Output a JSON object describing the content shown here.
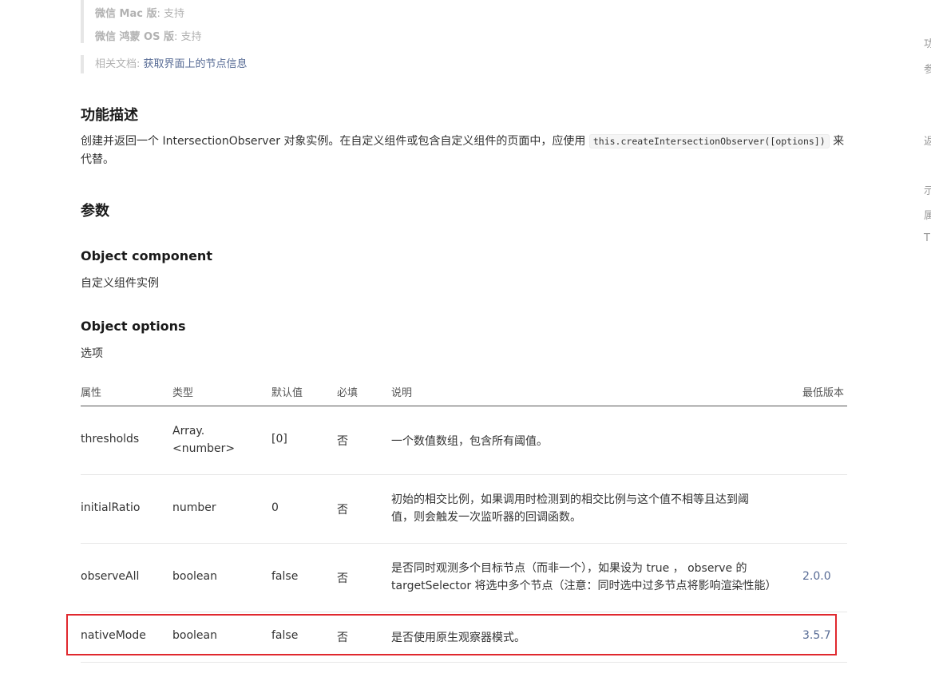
{
  "support": {
    "mac_label": "微信 Mac 版",
    "mac_value": "支持",
    "harmony_label": "微信 鸿蒙 OS 版",
    "harmony_value": "支持",
    "separator": ": "
  },
  "related_doc": {
    "label": "相关文档: ",
    "link_text": "获取界面上的节点信息"
  },
  "function": {
    "heading": "功能描述",
    "text_before": "创建并返回一个 IntersectionObserver 对象实例。在自定义组件或包含自定义组件的页面中，应使用 ",
    "code": "this.createIntersectionObserver([options])",
    "text_after": " 来代替。"
  },
  "params": {
    "heading": "参数",
    "component": {
      "heading": "Object component",
      "description": "自定义组件实例"
    },
    "options": {
      "heading": "Object options",
      "description": "选项"
    }
  },
  "table": {
    "headers": {
      "property": "属性",
      "type": "类型",
      "default": "默认值",
      "required": "必填",
      "description": "说明",
      "min_version": "最低版本"
    },
    "rows": [
      {
        "property": "thresholds",
        "type": "Array.<number>",
        "default": "[0]",
        "required": "否",
        "description": "一个数值数组，包含所有阈值。",
        "min_version": ""
      },
      {
        "property": "initialRatio",
        "type": "number",
        "default": "0",
        "required": "否",
        "description": "初始的相交比例，如果调用时检测到的相交比例与这个值不相等且达到阈值，则会触发一次监听器的回调函数。",
        "min_version": ""
      },
      {
        "property": "observeAll",
        "type": "boolean",
        "default": "false",
        "required": "否",
        "description": "是否同时观测多个目标节点（而非一个），如果设为 true ， observe 的 targetSelector 将选中多个节点（注意：同时选中过多节点将影响渲染性能）",
        "min_version": "2.0.0"
      },
      {
        "property": "nativeMode",
        "type": "boolean",
        "default": "false",
        "required": "否",
        "description": "是否使用原生观察器模式。",
        "min_version": "3.5.7"
      }
    ]
  },
  "right_rail": [
    "功",
    "参",
    "返",
    "示",
    "属",
    "T"
  ],
  "colors": {
    "link": "#576b95",
    "highlight": "#e0282e",
    "muted": "#b2b2b2"
  }
}
